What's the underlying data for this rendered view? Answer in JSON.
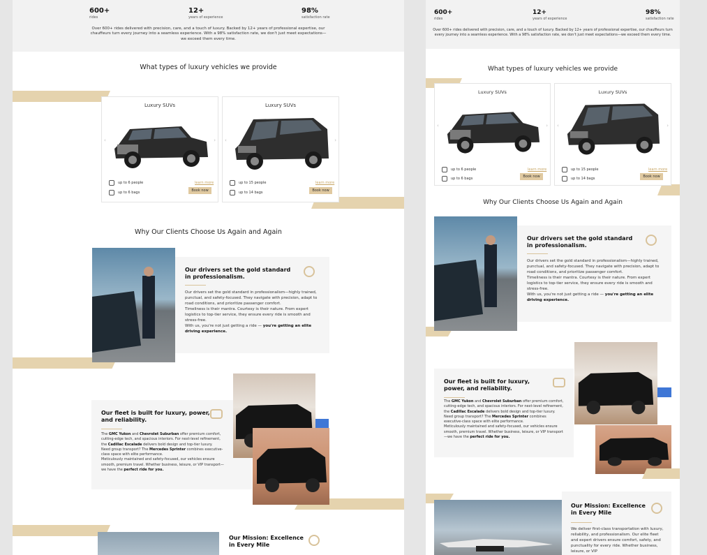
{
  "stats": [
    {
      "value": "600+",
      "label": "rides"
    },
    {
      "value": "12+",
      "label": "years of experience"
    },
    {
      "value": "98%",
      "label": "satisfaction rate"
    }
  ],
  "stats_text": "Over 600+ rides delivered with precision, care, and a touch of luxury. Backed by 12+ years of professional expertise, our chauffeurs turn every journey into a seamless experience. With a 98% satisfaction rate, we don't just meet expectations—we exceed them every time.",
  "vehicles_title": "What types of  luxury vehicles we provide",
  "vehicles": [
    {
      "title": "Luxury SUVs",
      "people": "up to 6 people",
      "bags": "up to 6 bags",
      "learn": "learn more",
      "book": "Book now"
    },
    {
      "title": "Luxury SUVs",
      "people": "up to 15 people",
      "bags": "up to 14 bags",
      "learn": "learn more",
      "book": "Book now"
    }
  ],
  "why_title": "Why Our Clients Choose Us Again and Again",
  "features": {
    "drivers": {
      "title": "Our drivers set the gold standard in professionalism.",
      "body": "Our drivers set the gold standard in professionalism—highly trained, punctual, and safety-focused. They navigate with precision, adapt to road conditions, and prioritize passenger comfort.",
      "body2": "Timeliness is their mantra. Courtesy is their nature. From expert logistics to top-tier service, they ensure every ride is smooth and stress-free.",
      "body3_pre": "With us, you're not just getting a ride — ",
      "body3_bold": "you're getting an elite driving experience."
    },
    "fleet": {
      "title": "Our fleet is built for luxury, power, and reliability.",
      "t1": "The ",
      "b1": "GMC Yukon",
      "t2": " and ",
      "b2": "Chevrolet Suburban",
      "t3": " offer premium comfort, cutting-edge tech, and spacious interiors. For next-level refinement, the ",
      "b3": "Cadillac Escalade",
      "t4": " delivers bold design and top-tier luxury.",
      "t5": "Need group transport? The ",
      "b5": "Mercedes Sprinter",
      "t6": " combines executive-class space with elite performance.",
      "t7": "Meticulously maintained and safety-focused, our vehicles ensure smooth, premium travel. Whether business, leisure, or VIP transport—we have the ",
      "b7": "perfect ride for you."
    },
    "mission": {
      "title": "Our Mission: Excellence in Every Mile",
      "body": "We deliver first-class transportation with luxury, reliability, and professionalism. Our elite fleet and expert drivers ensure comfort, safety, and punctuality for every ride. Whether business, leisure, or VIP"
    }
  },
  "colors": {
    "accent": "#e5d3ae",
    "gold_text": "#c7a564",
    "button": "#e0c9a0",
    "panel_bg": "#f5f5f5"
  }
}
